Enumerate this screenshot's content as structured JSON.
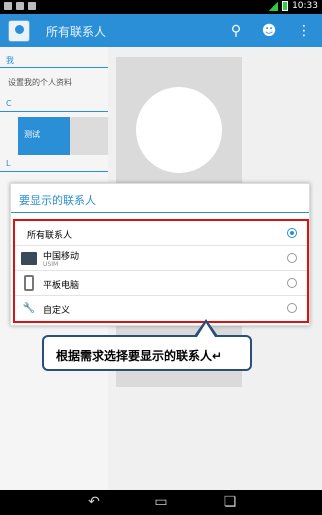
{
  "status_bar": {
    "time": "10:33"
  },
  "app_bar": {
    "title": "所有联系人",
    "icons": [
      "search-icon",
      "add-contact-icon",
      "overflow-menu-icon"
    ]
  },
  "contact_list": {
    "section_me": "我",
    "setup_profile": "设置我的个人资料",
    "section_c": "C",
    "selected_contact": "测试",
    "section_l": "L"
  },
  "dialog": {
    "title": "要显示的联系人",
    "options": [
      {
        "label": "所有联系人",
        "sublabel": "",
        "icon": "",
        "selected": true
      },
      {
        "label": "中国移动",
        "sublabel": "USIM",
        "icon": "sim-card-icon",
        "selected": false
      },
      {
        "label": "平板电脑",
        "sublabel": "",
        "icon": "tablet-icon",
        "selected": false
      },
      {
        "label": "自定义",
        "sublabel": "",
        "icon": "wrench-icon",
        "selected": false
      }
    ]
  },
  "callout": {
    "text": "根据需求选择要显示的联系人↵"
  },
  "nav": {
    "buttons": [
      "back-icon",
      "home-icon",
      "recent-apps-icon"
    ]
  },
  "colors": {
    "accent": "#2a8fd6",
    "highlight_border": "#dd1111",
    "callout_border": "#2a4f7a"
  }
}
